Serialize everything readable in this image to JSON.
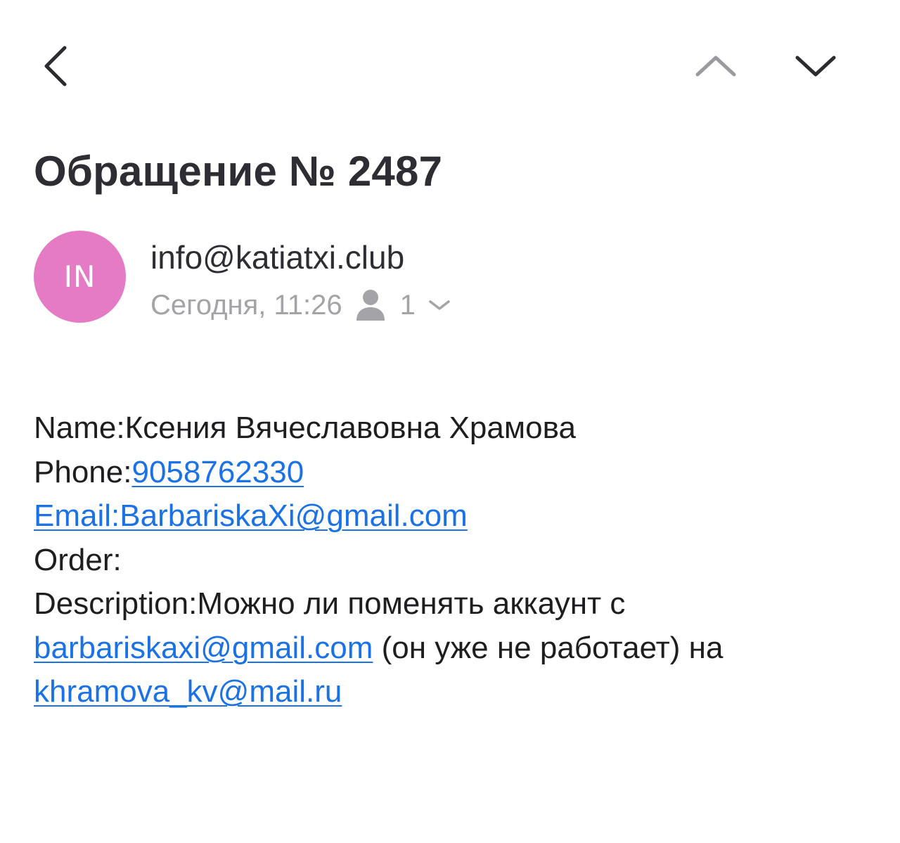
{
  "header": {
    "back_icon": "chevron-left-icon",
    "prev_icon": "chevron-up-icon",
    "next_icon": "chevron-down-icon"
  },
  "message": {
    "subject": "Обращение № 2487",
    "avatar_initials": "IN",
    "avatar_color": "#e57bc4",
    "sender": "info@katiatxi.club",
    "date": "Сегодня, 11:26",
    "recipients_icon": "person-icon",
    "recipient_count": "1",
    "expand_icon": "chevron-down-icon"
  },
  "body": {
    "name_label": "Name:",
    "name_value": "Ксения Вячеславовна Храмова",
    "phone_label": "Phone:",
    "phone_value": "9058762330",
    "email_line": "Email:BarbariskaXi@gmail.com",
    "order_label": "Order:",
    "description_label": "Description:",
    "description_text_1": "Можно ли поменять аккаунт с",
    "old_email": "barbariskaxi@gmail.com",
    "description_text_2": " (он уже не работает) на",
    "new_email": "khramova_kv@mail.ru"
  },
  "colors": {
    "link": "#1a72e6",
    "text": "#1e1e20",
    "meta": "#a3a3a8"
  }
}
